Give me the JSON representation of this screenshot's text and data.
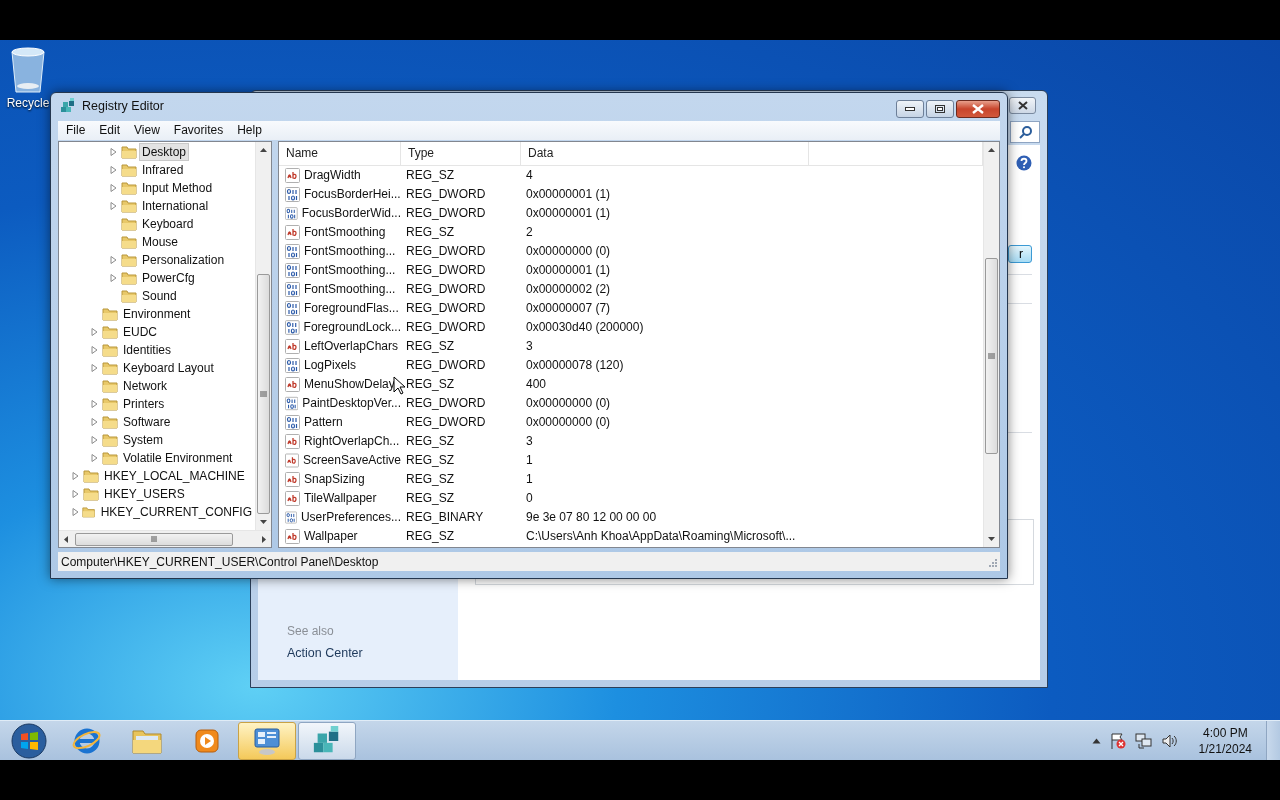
{
  "desktop": {
    "icons": [
      {
        "label": "Recycle"
      }
    ]
  },
  "background_window": {
    "button": "r",
    "side_panel": {
      "heading": "See also",
      "links": [
        "Action Center"
      ]
    }
  },
  "window": {
    "title": "Registry Editor",
    "menu": [
      "File",
      "Edit",
      "View",
      "Favorites",
      "Help"
    ],
    "tree": [
      {
        "children": [
          {
            "children": [
              {
                "label": "Desktop",
                "expandable": true,
                "selected": true
              },
              {
                "label": "Infrared",
                "expandable": true,
                "selected": false
              },
              {
                "label": "Input Method",
                "expandable": true,
                "selected": false
              },
              {
                "label": "International",
                "expandable": true,
                "selected": false
              },
              {
                "label": "Keyboard",
                "expandable": false,
                "selected": false
              },
              {
                "label": "Mouse",
                "expandable": false,
                "selected": false
              },
              {
                "label": "Personalization",
                "expandable": true,
                "selected": false
              },
              {
                "label": "PowerCfg",
                "expandable": true,
                "selected": false
              },
              {
                "label": "Sound",
                "expandable": false,
                "selected": false
              }
            ]
          },
          {
            "label": "Environment",
            "expandable": false,
            "selected": false
          },
          {
            "label": "EUDC",
            "expandable": true,
            "selected": false
          },
          {
            "label": "Identities",
            "expandable": true,
            "selected": false
          },
          {
            "label": "Keyboard Layout",
            "expandable": true,
            "selected": false
          },
          {
            "label": "Network",
            "expandable": false,
            "selected": false
          },
          {
            "label": "Printers",
            "expandable": true,
            "selected": false
          },
          {
            "label": "Software",
            "expandable": true,
            "selected": false
          },
          {
            "label": "System",
            "expandable": true,
            "selected": false
          },
          {
            "label": "Volatile Environment",
            "expandable": true,
            "selected": false
          }
        ]
      },
      {
        "label": "HKEY_LOCAL_MACHINE",
        "expandable": true,
        "selected": false
      },
      {
        "label": "HKEY_USERS",
        "expandable": true,
        "selected": false
      },
      {
        "label": "HKEY_CURRENT_CONFIG",
        "expandable": true,
        "selected": false
      }
    ],
    "columns": [
      "Name",
      "Type",
      "Data"
    ],
    "rows": [
      {
        "kind": "string",
        "name": "DragWidth",
        "type": "REG_SZ",
        "data": "4"
      },
      {
        "kind": "binary",
        "name": "FocusBorderHei...",
        "type": "REG_DWORD",
        "data": "0x00000001 (1)"
      },
      {
        "kind": "binary",
        "name": "FocusBorderWid...",
        "type": "REG_DWORD",
        "data": "0x00000001 (1)"
      },
      {
        "kind": "string",
        "name": "FontSmoothing",
        "type": "REG_SZ",
        "data": "2"
      },
      {
        "kind": "binary",
        "name": "FontSmoothing...",
        "type": "REG_DWORD",
        "data": "0x00000000 (0)"
      },
      {
        "kind": "binary",
        "name": "FontSmoothing...",
        "type": "REG_DWORD",
        "data": "0x00000001 (1)"
      },
      {
        "kind": "binary",
        "name": "FontSmoothing...",
        "type": "REG_DWORD",
        "data": "0x00000002 (2)"
      },
      {
        "kind": "binary",
        "name": "ForegroundFlas...",
        "type": "REG_DWORD",
        "data": "0x00000007 (7)"
      },
      {
        "kind": "binary",
        "name": "ForegroundLock...",
        "type": "REG_DWORD",
        "data": "0x00030d40 (200000)"
      },
      {
        "kind": "string",
        "name": "LeftOverlapChars",
        "type": "REG_SZ",
        "data": "3"
      },
      {
        "kind": "binary",
        "name": "LogPixels",
        "type": "REG_DWORD",
        "data": "0x00000078 (120)"
      },
      {
        "kind": "string",
        "name": "MenuShowDelay",
        "type": "REG_SZ",
        "data": "400"
      },
      {
        "kind": "binary",
        "name": "PaintDesktopVer...",
        "type": "REG_DWORD",
        "data": "0x00000000 (0)"
      },
      {
        "kind": "binary",
        "name": "Pattern",
        "type": "REG_DWORD",
        "data": "0x00000000 (0)"
      },
      {
        "kind": "string",
        "name": "RightOverlapCh...",
        "type": "REG_SZ",
        "data": "3"
      },
      {
        "kind": "string",
        "name": "ScreenSaveActive",
        "type": "REG_SZ",
        "data": "1"
      },
      {
        "kind": "string",
        "name": "SnapSizing",
        "type": "REG_SZ",
        "data": "1"
      },
      {
        "kind": "string",
        "name": "TileWallpaper",
        "type": "REG_SZ",
        "data": "0"
      },
      {
        "kind": "binary",
        "name": "UserPreferences...",
        "type": "REG_BINARY",
        "data": "9e 3e 07 80 12 00 00 00"
      },
      {
        "kind": "string",
        "name": "Wallpaper",
        "type": "REG_SZ",
        "data": "C:\\Users\\Anh Khoa\\AppData\\Roaming\\Microsoft\\..."
      }
    ],
    "status_bar": "Computer\\HKEY_CURRENT_USER\\Control Panel\\Desktop"
  },
  "taskbar": {
    "items": [
      {
        "kind": "browser",
        "open": false,
        "highlighted": false
      },
      {
        "kind": "folder",
        "open": false,
        "highlighted": false
      },
      {
        "kind": "media",
        "open": false,
        "highlighted": false
      },
      {
        "kind": "control-panel",
        "open": true,
        "highlighted": true
      },
      {
        "kind": "registry",
        "open": true,
        "highlighted": false
      }
    ],
    "time": "4:00 PM",
    "date": "1/21/2024"
  }
}
